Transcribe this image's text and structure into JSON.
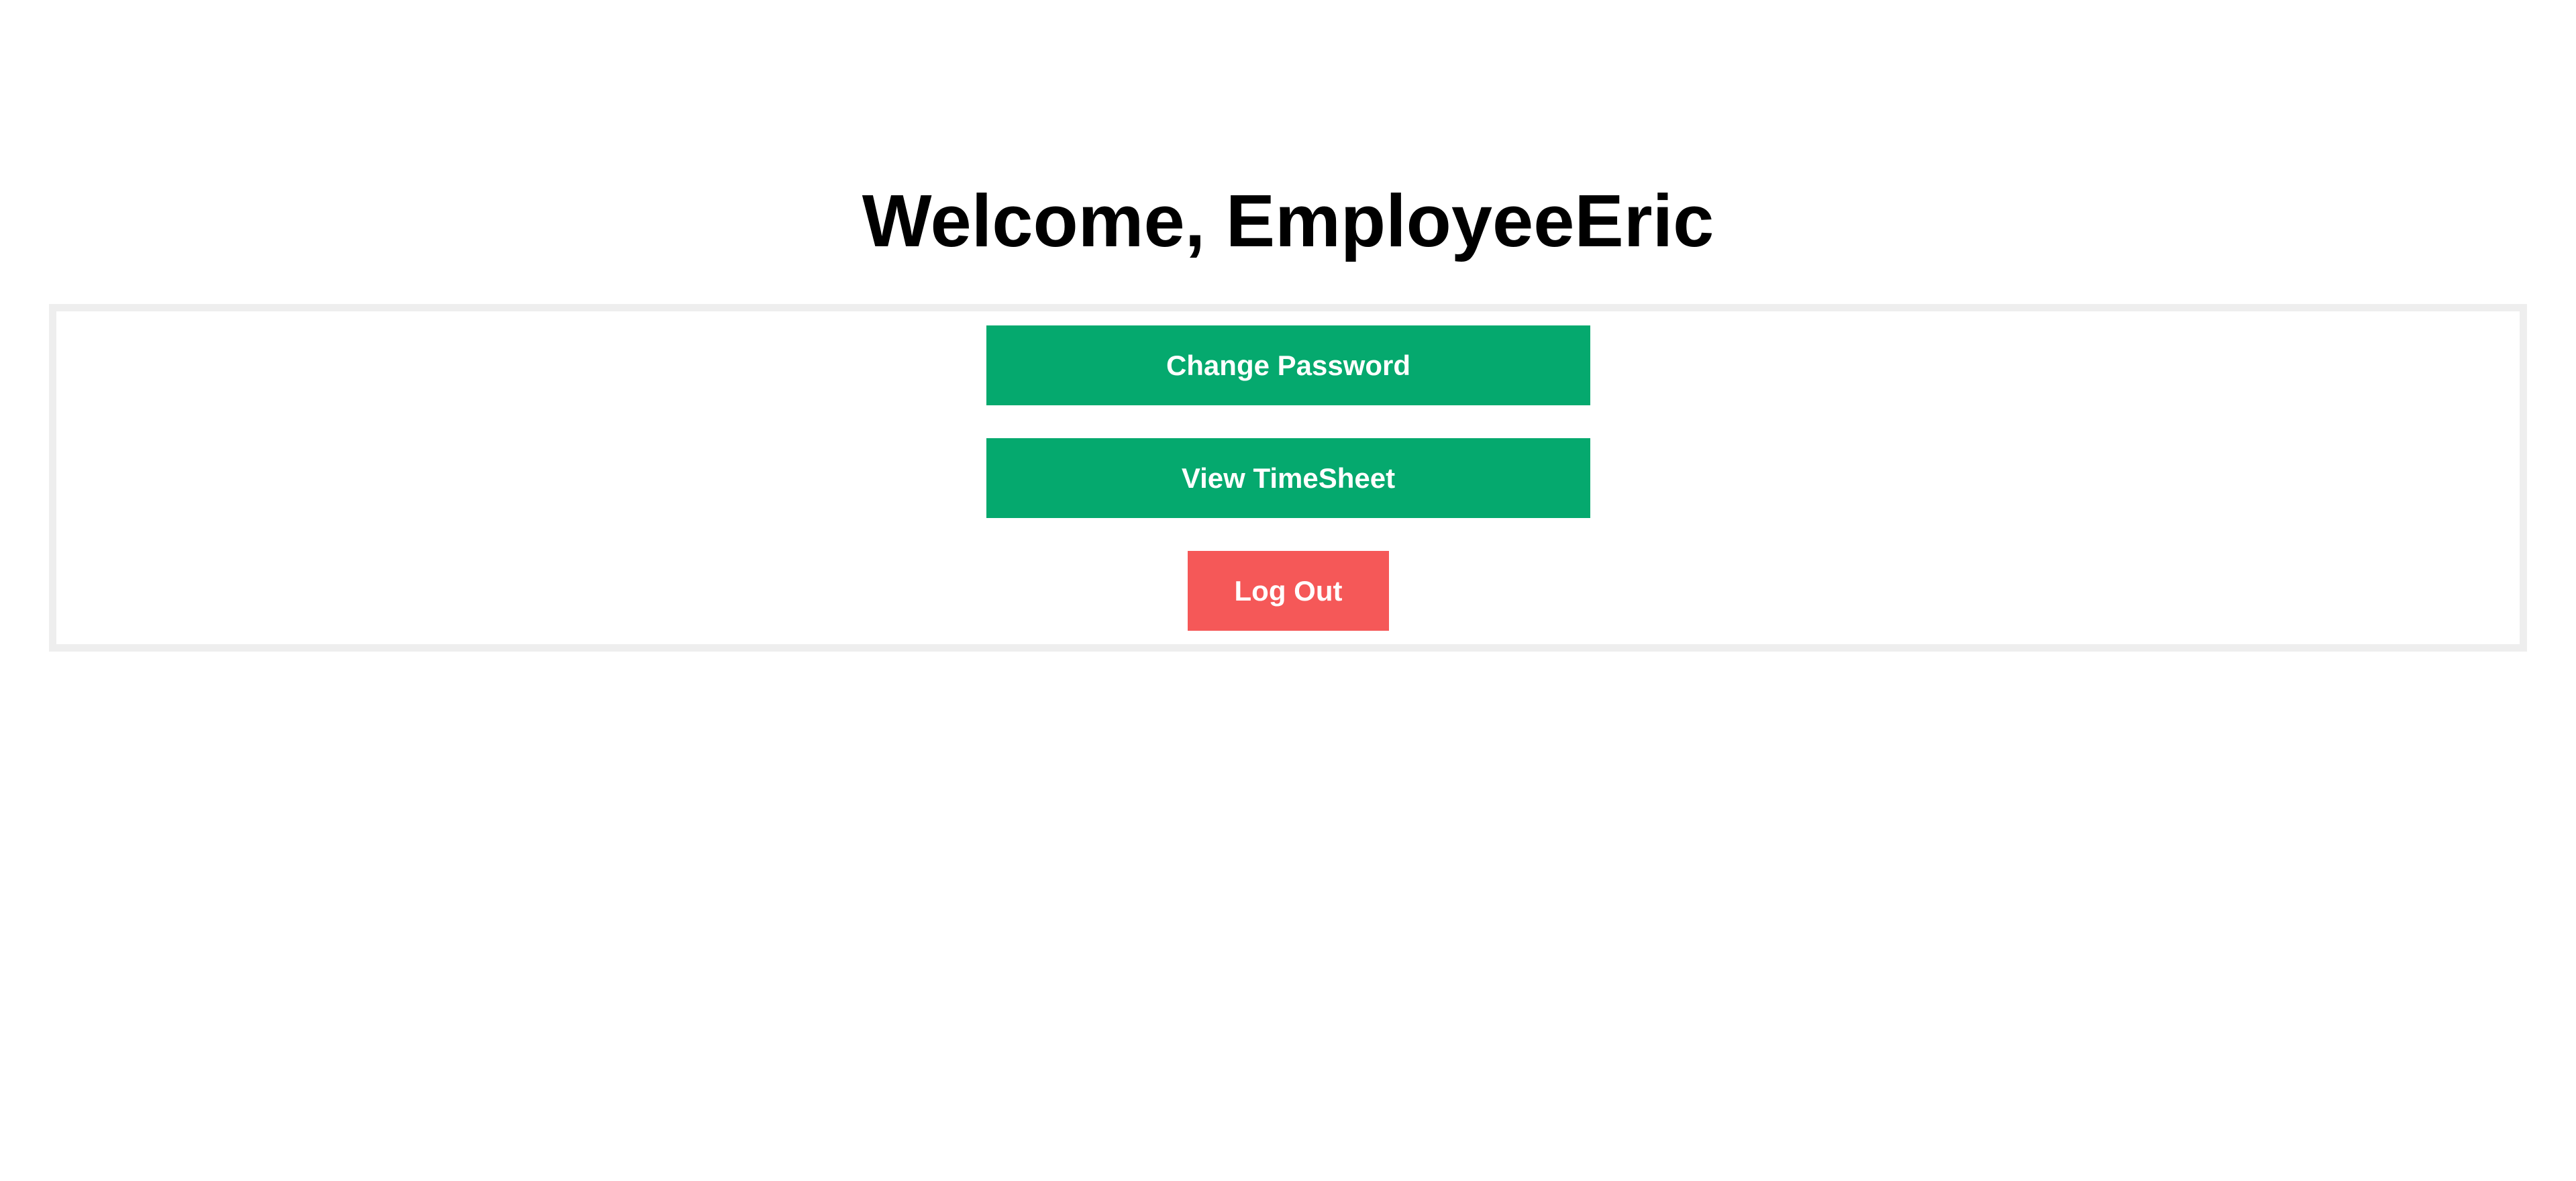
{
  "header": {
    "title": "Welcome, EmployeeEric"
  },
  "actions": {
    "change_password_label": "Change Password",
    "view_timesheet_label": "View TimeSheet",
    "logout_label": "Log Out"
  },
  "colors": {
    "primary_button": "#05a96e",
    "danger_button": "#f55858",
    "panel_border": "#eeeeee",
    "title_text": "#000000"
  }
}
